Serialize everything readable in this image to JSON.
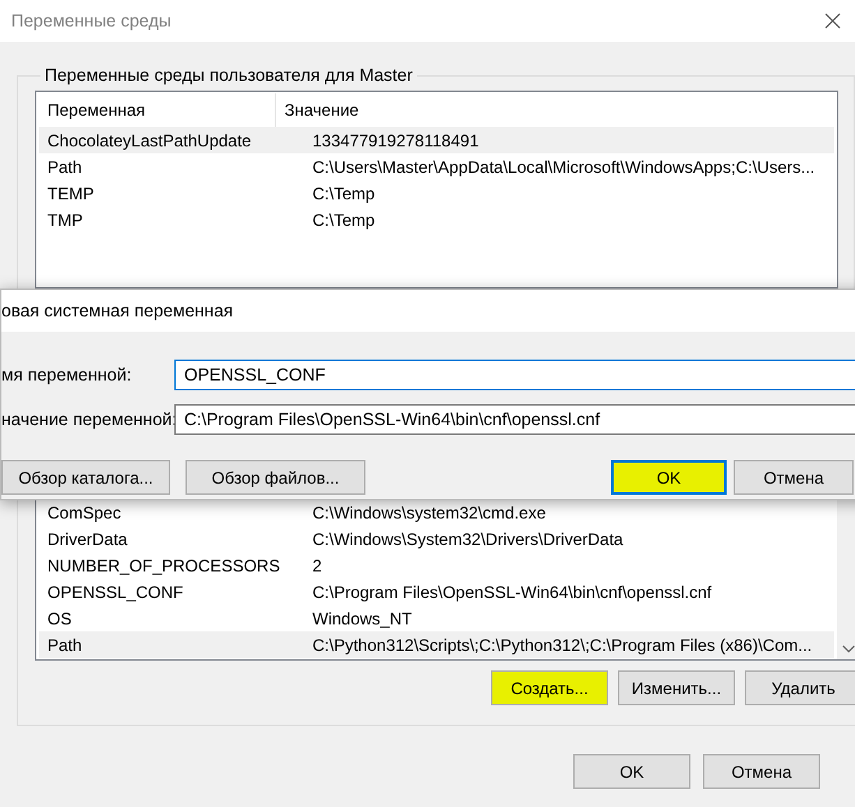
{
  "window": {
    "title": "Переменные среды"
  },
  "user_variables": {
    "title": "Переменные среды пользователя для Master",
    "columns": [
      "Переменная",
      "Значение"
    ],
    "rows": [
      {
        "name": "ChocolateyLastPathUpdate",
        "value": "133477919278118491",
        "selected": true
      },
      {
        "name": "Path",
        "value": "C:\\Users\\Master\\AppData\\Local\\Microsoft\\WindowsApps;C:\\Users...",
        "selected": false
      },
      {
        "name": "TEMP",
        "value": "C:\\Temp",
        "selected": false
      },
      {
        "name": "TMP",
        "value": "C:\\Temp",
        "selected": false
      }
    ]
  },
  "system_variables": {
    "rows": [
      {
        "name": "ComSpec",
        "value": "C:\\Windows\\system32\\cmd.exe",
        "selected": false
      },
      {
        "name": "DriverData",
        "value": "C:\\Windows\\System32\\Drivers\\DriverData",
        "selected": false
      },
      {
        "name": "NUMBER_OF_PROCESSORS",
        "value": "2",
        "selected": false
      },
      {
        "name": "OPENSSL_CONF",
        "value": "C:\\Program Files\\OpenSSL-Win64\\bin\\cnf\\openssl.cnf",
        "selected": false
      },
      {
        "name": "OS",
        "value": "Windows_NT",
        "selected": false
      },
      {
        "name": "Path",
        "value": "C:\\Python312\\Scripts\\;C:\\Python312\\;C:\\Program Files (x86)\\Com...",
        "selected": true
      }
    ],
    "buttons": [
      {
        "label": "Создать...",
        "highlighted": true
      },
      {
        "label": "Изменить...",
        "highlighted": false
      },
      {
        "label": "Удалить",
        "highlighted": false
      }
    ]
  },
  "buttons": [
    {
      "label": "OK",
      "highlighted": false
    },
    {
      "label": "Отмена",
      "highlighted": false
    }
  ],
  "new_variable_dialog": {
    "title": "овая системная переменная",
    "fields": [
      {
        "label": "мя переменной:",
        "value": "OPENSSL_CONF"
      },
      {
        "label": "начение переменной:",
        "value": "C:\\Program Files\\OpenSSL-Win64\\bin\\cnf\\openssl.cnf"
      }
    ],
    "left_buttons": [
      {
        "label": "Обзор каталога...",
        "highlighted": false
      },
      {
        "label": "Обзор файлов...",
        "highlighted": false
      }
    ],
    "right_buttons": [
      {
        "label": "OK",
        "highlighted": true,
        "focused": true
      },
      {
        "label": "Отмена",
        "highlighted": false,
        "focused": false
      }
    ]
  }
}
